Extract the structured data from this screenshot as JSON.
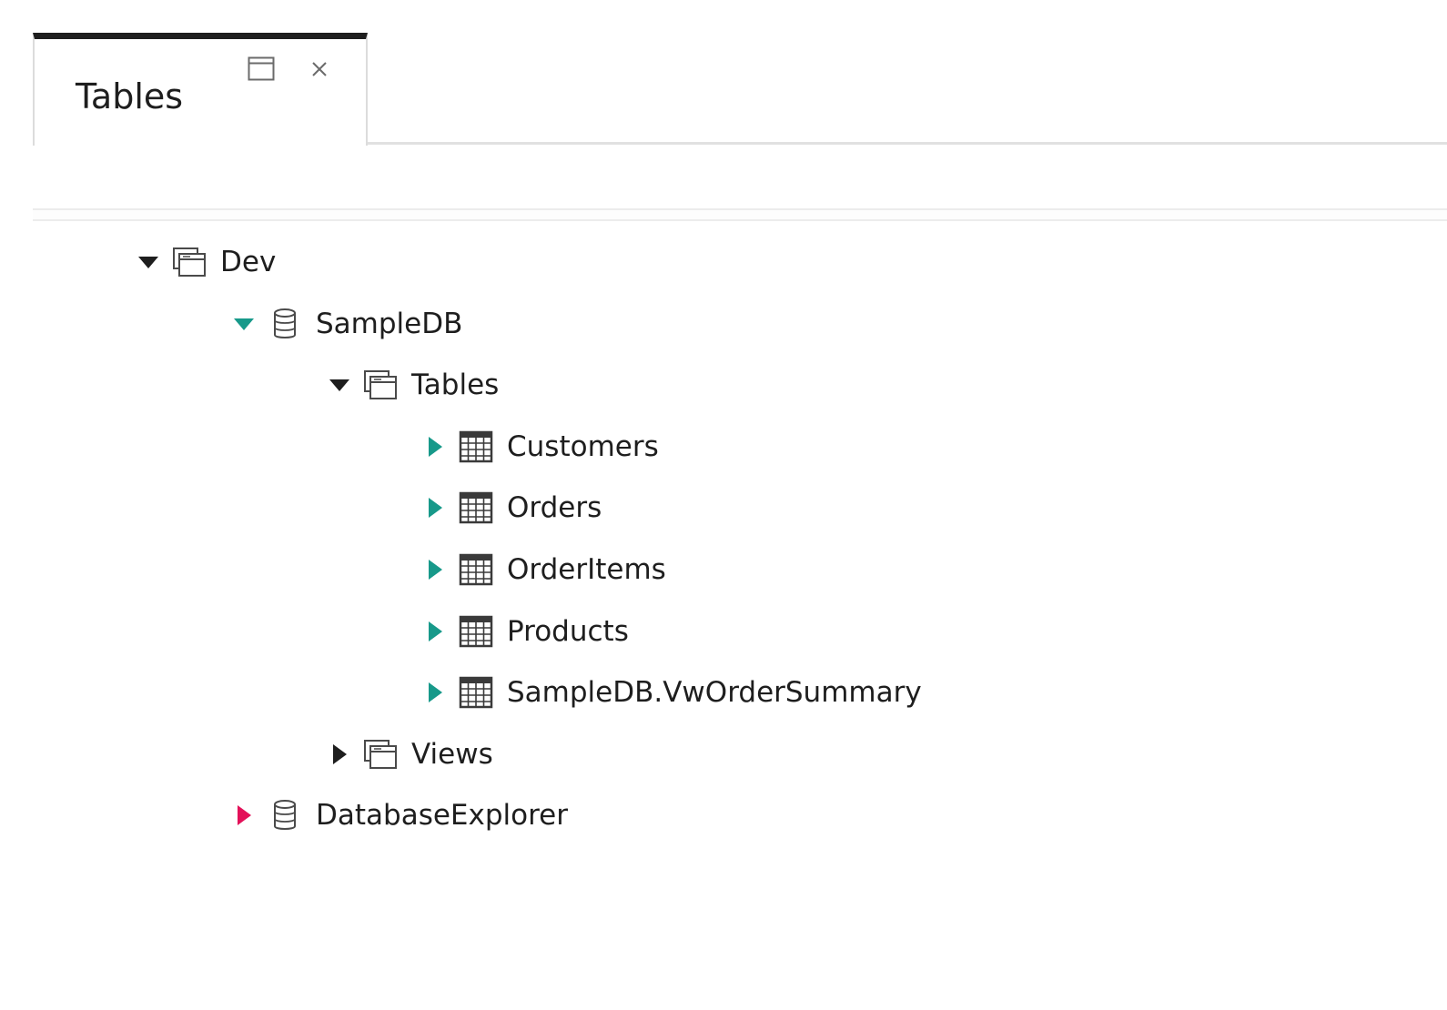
{
  "tab": {
    "title": "Tables",
    "float_icon": "window-float-icon",
    "close_icon": "close-icon"
  },
  "colors": {
    "accent_teal": "#17998a",
    "accent_pink": "#e31159",
    "dark": "#1e1e1e"
  },
  "tree": {
    "nodes": [
      {
        "label": "Dev",
        "depth": 0,
        "expander": "expanded",
        "expander_color": "#1e1e1e",
        "icon": "folder-icon"
      },
      {
        "label": "SampleDB",
        "depth": 1,
        "expander": "expanded",
        "expander_color": "#17998a",
        "icon": "database-icon"
      },
      {
        "label": "Tables",
        "depth": 2,
        "expander": "expanded",
        "expander_color": "#1e1e1e",
        "icon": "folder-icon"
      },
      {
        "label": "Customers",
        "depth": 3,
        "expander": "collapsed",
        "expander_color": "#17998a",
        "icon": "table-icon"
      },
      {
        "label": "Orders",
        "depth": 3,
        "expander": "collapsed",
        "expander_color": "#17998a",
        "icon": "table-icon"
      },
      {
        "label": "OrderItems",
        "depth": 3,
        "expander": "collapsed",
        "expander_color": "#17998a",
        "icon": "table-icon"
      },
      {
        "label": "Products",
        "depth": 3,
        "expander": "collapsed",
        "expander_color": "#17998a",
        "icon": "table-icon"
      },
      {
        "label": "SampleDB.VwOrderSummary",
        "depth": 3,
        "expander": "collapsed",
        "expander_color": "#17998a",
        "icon": "table-icon"
      },
      {
        "label": "Views",
        "depth": 2,
        "expander": "collapsed",
        "expander_color": "#1e1e1e",
        "icon": "folder-icon"
      },
      {
        "label": "DatabaseExplorer",
        "depth": 1,
        "expander": "collapsed",
        "expander_color": "#e31159",
        "icon": "database-icon"
      }
    ]
  }
}
